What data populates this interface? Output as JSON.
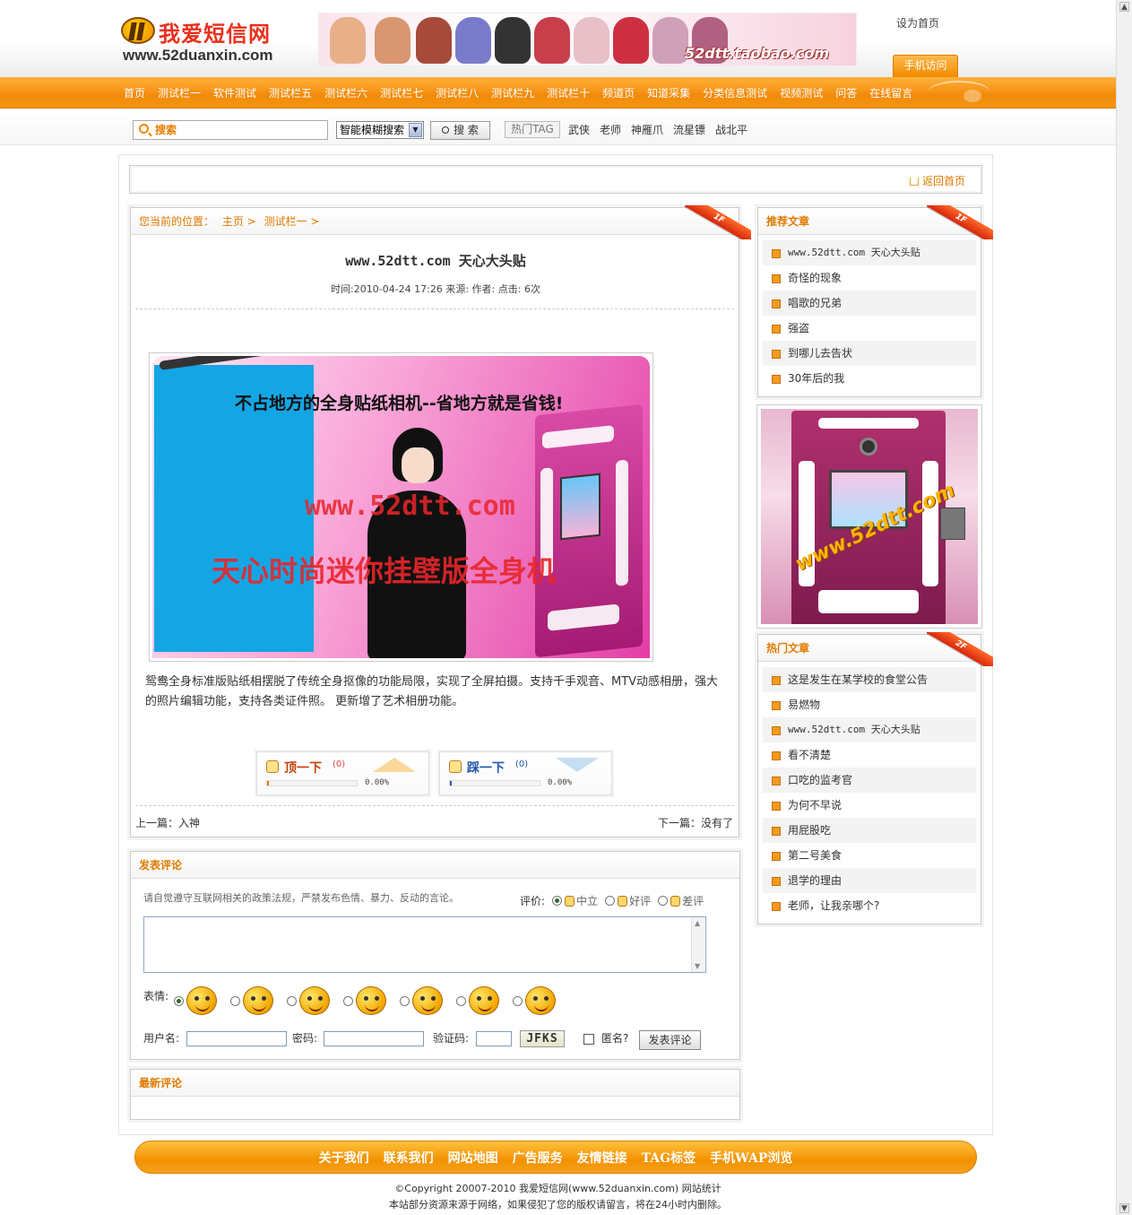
{
  "header": {
    "logo_text": "我爱短信网",
    "logo_domain": "www.52duanxin.com",
    "banner_text": "52dtt.taobao.com",
    "set_home": "设为首页",
    "mobile_tab": "手机访问"
  },
  "nav": {
    "items": [
      "首页",
      "测试栏一",
      "软件测试",
      "测试栏五",
      "测试栏六",
      "测试栏七",
      "测试栏八",
      "测试栏九",
      "测试栏十",
      "频道页",
      "知道采集",
      "分类信息测试",
      "视频测试",
      "问答",
      "在线留言"
    ]
  },
  "search": {
    "placeholder": "搜索",
    "mode": "智能模糊搜索",
    "button": "搜 索",
    "hot_tag_label": "热门TAG",
    "hot_tags": [
      "武侠",
      "老师",
      "神雁爪",
      "流星镖",
      "战北平"
    ]
  },
  "home_bar": {
    "back_home": "返回首页"
  },
  "article": {
    "breadcrumb_prefix": "您当前的位置：",
    "breadcrumb_home": "主页",
    "breadcrumb_sep": ">",
    "breadcrumb_cat": "测试栏一",
    "ribbon": "1F",
    "title": "www.52dtt.com 天心大头贴",
    "meta": "时间:2010-04-24 17:26 来源: 作者: 点击: 6次",
    "image_headline": "不占地方的全身贴纸相机--省地方就是省钱!",
    "image_url": "www.52dtt.com",
    "image_slogan": "天心时尚迷你挂壁版全身机",
    "body": "鸳鸯全身标准版贴纸相摆脱了传统全身抠像的功能局限，实现了全屏拍摄。支持千手观音、MTV动感相册，强大的照片编辑功能，支持各类证件照。 更新增了艺术相册功能。",
    "vote_up": {
      "label": "顶一下",
      "count": "(0)",
      "percent": "0.00%"
    },
    "vote_down": {
      "label": "踩一下",
      "count": "(0)",
      "percent": "0.00%"
    },
    "prev": "上一篇：入神",
    "next": "下一篇：没有了"
  },
  "comment": {
    "title": "发表评论",
    "note": "请自觉遵守互联网相关的政策法规，严禁发布色情、暴力、反动的言论。",
    "rate_label": "评价:",
    "rate_options": [
      "中立",
      "好评",
      "差评"
    ],
    "emotion_label": "表情:",
    "username_label": "用户名:",
    "password_label": "密码:",
    "captcha_label": "验证码:",
    "captcha_value": "JFKS",
    "anonymous_label": "匿名?",
    "submit": "发表评论"
  },
  "latest": {
    "title": "最新评论"
  },
  "sidebar": {
    "recommended": {
      "title": "推荐文章",
      "ribbon": "1F",
      "items": [
        "www.52dtt.com 天心大头贴",
        "奇怪的现象",
        "唱歌的兄弟",
        "强盗",
        "到哪儿去告状",
        "30年后的我"
      ]
    },
    "ad_watermark": "www.52dtt.com",
    "hot": {
      "title": "热门文章",
      "ribbon": "2F",
      "items": [
        "这是发生在某学校的食堂公告",
        "易燃物",
        "www.52dtt.com 天心大头贴",
        "看不清楚",
        "口吃的监考官",
        "为何不早说",
        "用屁股吃",
        "第二号美食",
        "退学的理由",
        "老师，让我亲哪个?"
      ]
    }
  },
  "footer": {
    "links": [
      "关于我们",
      "联系我们",
      "网站地图",
      "广告服务",
      "友情链接",
      "TAG标签",
      "手机WAP浏览"
    ],
    "copyright": "©Copyright 20007-2010 我爱短信网(www.52duanxin.com) 网站统计",
    "disclaimer": "本站部分资源来源于网络，如果侵犯了您的版权请留言，将在24小时内删除。"
  },
  "colors": {
    "accent": "#f28a0c",
    "link": "#e07a00"
  }
}
